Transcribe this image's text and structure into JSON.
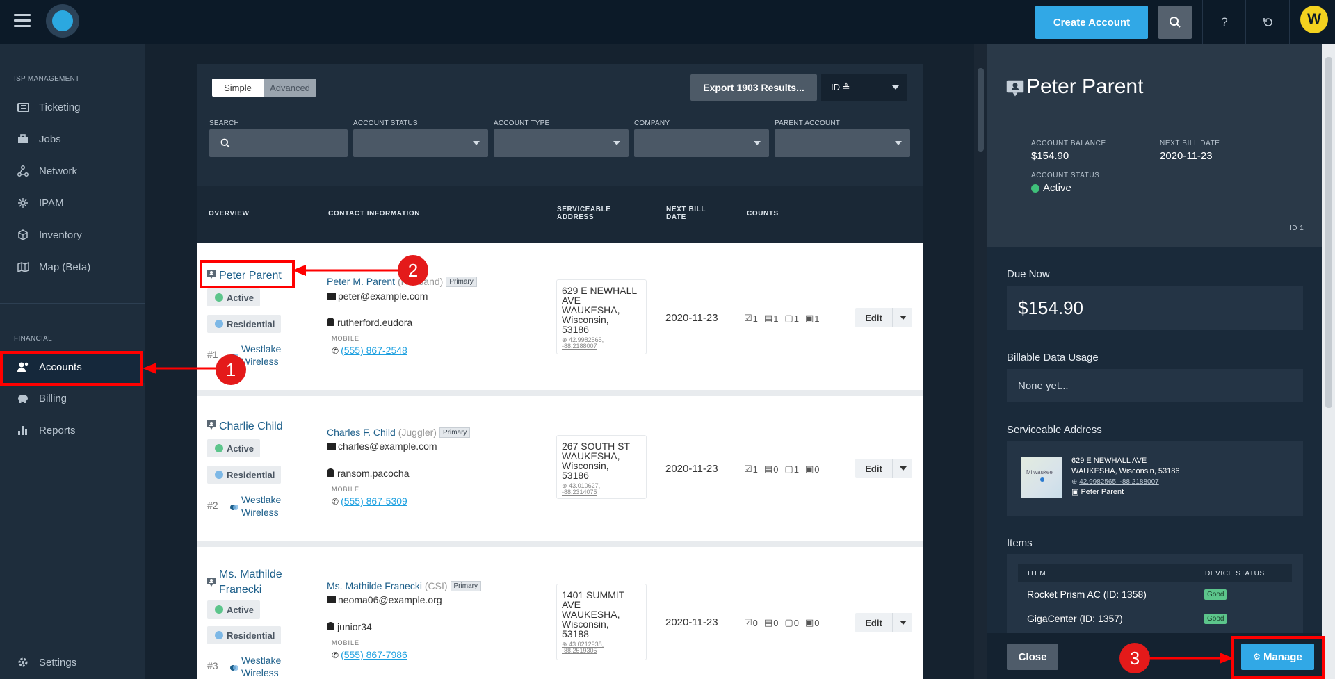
{
  "topbar": {
    "create_account": "Create Account",
    "help": "?",
    "avatar_letter": "W",
    "accent": "#31a8e6"
  },
  "sidebar": {
    "isp_heading": "ISP MANAGEMENT",
    "isp_items": [
      {
        "label": "Ticketing",
        "icon": "ticket-icon"
      },
      {
        "label": "Jobs",
        "icon": "briefcase-icon"
      },
      {
        "label": "Network",
        "icon": "network-icon"
      },
      {
        "label": "IPAM",
        "icon": "ipam-icon"
      },
      {
        "label": "Inventory",
        "icon": "box-icon"
      },
      {
        "label": "Map (Beta)",
        "icon": "map-icon"
      }
    ],
    "financial_heading": "FINANCIAL",
    "financial_items": [
      {
        "label": "Accounts",
        "icon": "accounts-icon",
        "active": true
      },
      {
        "label": "Billing",
        "icon": "piggy-bank-icon"
      },
      {
        "label": "Reports",
        "icon": "bar-chart-icon"
      }
    ],
    "settings": "Settings"
  },
  "filters": {
    "simple": "Simple",
    "advanced": "Advanced",
    "export": "Export 1903 Results...",
    "sort": "ID ≜",
    "search_label": "SEARCH",
    "status_label": "ACCOUNT STATUS",
    "type_label": "ACCOUNT TYPE",
    "company_label": "COMPANY",
    "parent_label": "PARENT ACCOUNT"
  },
  "table": {
    "headers": {
      "overview": "OVERVIEW",
      "contact": "CONTACT INFORMATION",
      "address_1": "SERVICEABLE",
      "address_2": "ADDRESS",
      "bill_1": "NEXT BILL",
      "bill_2": "DATE",
      "counts": "COUNTS"
    },
    "rows": [
      {
        "name": "Peter Parent",
        "status": "Active",
        "type": "Residential",
        "num": "#1",
        "company_1": "Westlake",
        "company_2": "Wireless",
        "contact_name": "Peter M. Parent",
        "contact_role": "(Husband)",
        "primary": "Primary",
        "email": "peter@example.com",
        "username": "rutherford.eudora",
        "mobile_label": "MOBILE",
        "phone": "(555) 867-2548",
        "addr": [
          "629 E NEWHALL",
          "AVE",
          "WAUKESHA,",
          "Wisconsin,",
          "53186"
        ],
        "coords_1": "42.9982565,",
        "coords_2": "-88.2188007",
        "bill_date": "2020-11-23",
        "counts": [
          "1",
          "1",
          "1",
          "1"
        ],
        "edit": "Edit"
      },
      {
        "name": "Charlie Child",
        "status": "Active",
        "type": "Residential",
        "num": "#2",
        "company_1": "Westlake",
        "company_2": "Wireless",
        "contact_name": "Charles F. Child",
        "contact_role": "(Juggler)",
        "primary": "Primary",
        "email": "charles@example.com",
        "username": "ransom.pacocha",
        "mobile_label": "MOBILE",
        "phone": "(555) 867-5309",
        "addr": [
          "267 SOUTH ST",
          "WAUKESHA,",
          "Wisconsin,",
          "53186"
        ],
        "coords_1": "43.010627,",
        "coords_2": "-88.2314075",
        "bill_date": "2020-11-23",
        "counts": [
          "1",
          "0",
          "1",
          "0"
        ],
        "edit": "Edit"
      },
      {
        "name_1": "Ms. Mathilde",
        "name_2": "Franecki",
        "status": "Active",
        "type": "Residential",
        "num": "#3",
        "company_1": "Westlake",
        "company_2": "Wireless",
        "contact_name": "Ms. Mathilde Franecki",
        "contact_role": "(CSI)",
        "primary": "Primary",
        "email": "neoma06@example.org",
        "username": "junior34",
        "mobile_label": "MOBILE",
        "phone": "(555) 867-7986",
        "addr": [
          "1401 SUMMIT",
          "AVE",
          "WAUKESHA,",
          "Wisconsin,",
          "53188"
        ],
        "coords_1": "43.0212938,",
        "coords_2": "-88.2519305",
        "bill_date": "2020-11-23",
        "counts": [
          "0",
          "0",
          "0",
          "0"
        ],
        "edit": "Edit"
      }
    ]
  },
  "panel": {
    "name": "Peter Parent",
    "balance_label": "ACCOUNT BALANCE",
    "balance": "$154.90",
    "next_bill_label": "NEXT BILL DATE",
    "next_bill": "2020-11-23",
    "status_label": "ACCOUNT STATUS",
    "status": "Active",
    "id": "ID 1",
    "due_now_label": "Due Now",
    "due_now": "$154.90",
    "usage_label": "Billable Data Usage",
    "usage": "None yet...",
    "address_label": "Serviceable Address",
    "address_1": "629 E NEWHALL AVE",
    "address_2": "WAUKESHA, Wisconsin, 53186",
    "address_coords": "42.9982565, -88.2188007",
    "address_owner": "Peter Parent",
    "map_city": "Milwaukee",
    "items_label": "Items",
    "item_col": "ITEM",
    "device_col": "DEVICE STATUS",
    "items": [
      {
        "name": "Rocket Prism AC (ID: 1358)",
        "status": "Good"
      },
      {
        "name": "GigaCenter (ID: 1357)",
        "status": "Good"
      }
    ],
    "close": "Close",
    "manage": "Manage"
  },
  "annotations": {
    "step1": "1",
    "step2": "2",
    "step3": "3",
    "color": "#ff0000"
  }
}
